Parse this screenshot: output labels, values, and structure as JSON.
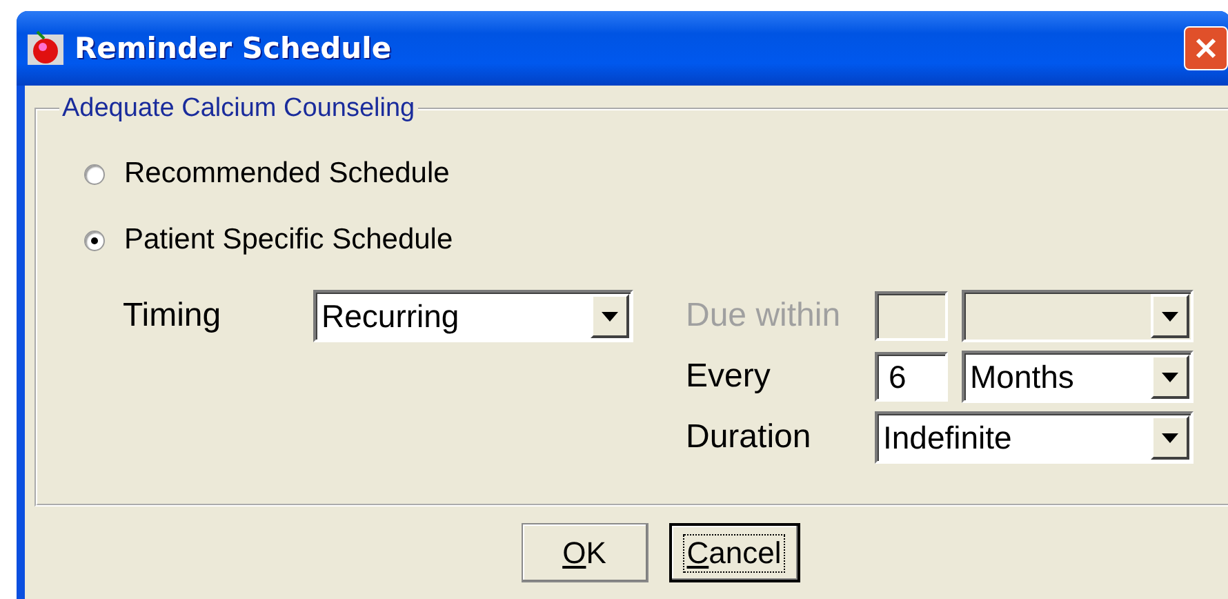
{
  "window": {
    "title": "Reminder Schedule"
  },
  "group": {
    "legend": "Adequate Calcium Counseling"
  },
  "schedule_options": [
    {
      "label": "Recommended Schedule",
      "selected": false
    },
    {
      "label": "Patient Specific Schedule",
      "selected": true
    }
  ],
  "timing": {
    "label": "Timing",
    "value": "Recurring"
  },
  "fields": [
    {
      "kind": "number_unit",
      "label": "Due within",
      "disabled": true
    },
    {
      "kind": "number_unit",
      "label": "Every",
      "disabled": false,
      "number": "6",
      "unit": "Months"
    },
    {
      "kind": "combo",
      "label": "Duration",
      "disabled": false,
      "value": "Indefinite"
    }
  ],
  "buttons": [
    {
      "label": "OK",
      "mnemonic_first": true,
      "default": false
    },
    {
      "label": "Cancel",
      "mnemonic_first": true,
      "default": true
    }
  ]
}
